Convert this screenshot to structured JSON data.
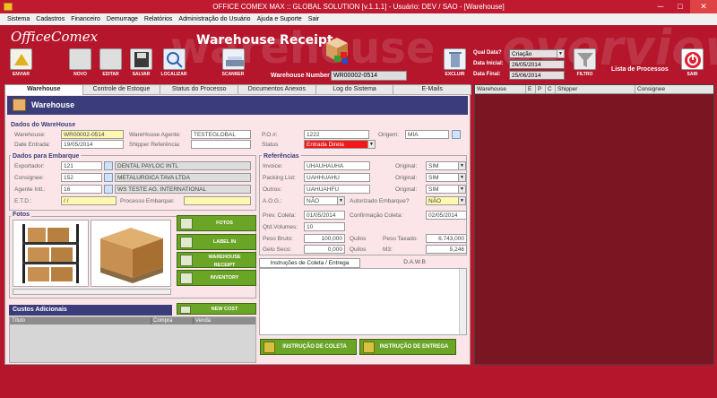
{
  "titlebar": {
    "title": "OFFICE COMEX MAX :: GLOBAL SOLUTION [v.1.1.1] - Usuário: DEV / SAO - [Warehouse]",
    "minimize": "─",
    "maximize": "□",
    "close": "✕"
  },
  "menu": [
    "Sistema",
    "Cadastros",
    "Financeiro",
    "Demurrage",
    "Relatórios",
    "Administração do Usuário",
    "Ajuda e Suporte",
    "Sair"
  ],
  "header": {
    "logo": "OfficeComex",
    "title": "Warehouse Receipt",
    "bg_left": "warehouse",
    "bg_right": "overview",
    "warehouse_number_label": "Warehouse Number",
    "warehouse_number": "WR00002-0514",
    "lista": "Lista de Processos"
  },
  "toolbar": {
    "enviar": "ENVIAR",
    "novo": "NOVO",
    "editar": "EDITAR",
    "salvar": "SALVAR",
    "localizar": "LOCALIZAR",
    "scanner": "SCANNER",
    "excluir": "EXCLUIR",
    "filtro": "FILTRO",
    "sair": "SAIR"
  },
  "filter": {
    "qual_label": "Qual Data?",
    "qual_value": "Criação",
    "inicial_label": "Data Inicial:",
    "inicial_value": "26/05/2014",
    "final_label": "Data Final:",
    "final_value": "25/06/2014"
  },
  "tabs": [
    "Warehouse",
    "Controle de Estoque",
    "Status do Processo",
    "Documentos Anexos",
    "Log do Sistema",
    "E-Mails"
  ],
  "section_title": "Warehouse",
  "dados_wh": {
    "title": "Dados do WareHouse",
    "warehouse_label": "Warehouse:",
    "warehouse": "WR00002-0514",
    "agente_label": "WareHouse Agente:",
    "agente": "TESTEGLOBAL",
    "po_label": "P.O.#:",
    "po": "1222",
    "origem_label": "Origem:",
    "origem": "MIA",
    "entrada_label": "Date Entrada:",
    "entrada": "19/05/2014",
    "shipper_label": "Shipper Referência:",
    "shipper": "",
    "status_label": "Status",
    "status": "Entrada Direta"
  },
  "embarque": {
    "title": "Dados para Embarque",
    "exportador_label": "Exportador:",
    "exportador_code": "121",
    "exportador": "DENTAL PAYLOC INTL",
    "consignee_label": "Consignee:",
    "consignee_code": "152",
    "consignee": "METALURGICA TAVA LTDA",
    "agente_label": "Agente Intl.:",
    "agente_code": "16",
    "agente": "WS TESTE AG. INTERNATIONAL",
    "etd_label": "E.T.D.:",
    "etd": "/ /",
    "processo_label": "Processo Embarque:",
    "processo": ""
  },
  "referencias": {
    "title": "Referências",
    "invoice_label": "Invoice:",
    "invoice": "UHAUHAUHA",
    "packing_label": "Packing List:",
    "packing": "UAHHUAHU",
    "outros_label": "Outros:",
    "outros": "UAHUAHFU",
    "original_label": "Original:",
    "original1": "SIM",
    "original2": "SIM",
    "original3": "SIM",
    "aog_label": "A.O.G.:",
    "aog": "NÃO",
    "autorizado_label": "Autorizado Embarque?",
    "autorizado": "NÃO",
    "prev_coleta_label": "Prev. Coleta:",
    "prev_coleta": "01/05/2014",
    "confirmacao_label": "Confirmação Coleta:",
    "confirmacao": "02/05/2014",
    "volumes_label": "Qtd.Volumes:",
    "volumes": "10",
    "peso_bruto_label": "Peso Bruto:",
    "peso_bruto": "100,000",
    "quilos1": "Quilos",
    "peso_taxado_label": "Peso Taxado:",
    "peso_taxado": "6.743,000",
    "gelo_label": "Gelo Seco:",
    "gelo": "0,000",
    "quilos2": "Quilos",
    "m3_label": "M3:",
    "m3": "5,246"
  },
  "fotos": {
    "title": "Fotos",
    "fotos_btn": "FOTOS",
    "label_btn": "LABEL IN",
    "receipt_btn_l1": "WAREHOUSE",
    "receipt_btn_l2": "RECEIPT",
    "inventory_btn": "INVENTORY"
  },
  "custos": {
    "title": "Custos Adicionais",
    "new_btn": "NEW COST",
    "cols": [
      "Título",
      "Compra",
      "Venda"
    ]
  },
  "instrucoes": {
    "tab1": "Instruções de Coleta / Entrega",
    "tab2": "D.A.W.B",
    "btn_coleta": "INSTRUÇÃO DE COLETA",
    "btn_entrega": "INSTRUÇÃO DE ENTREGA"
  },
  "list": {
    "cols": [
      "Warehouse",
      "E",
      "P",
      "C",
      "Shipper",
      "Consignee"
    ]
  }
}
